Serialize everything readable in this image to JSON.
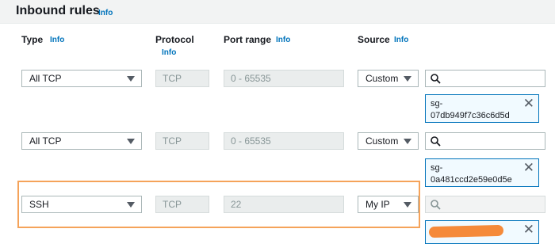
{
  "title": "Inbound rules",
  "info_label": "Info",
  "columns": {
    "type": "Type",
    "protocol": "Protocol",
    "port_range": "Port range",
    "source": "Source"
  },
  "rules": [
    {
      "type": "All TCP",
      "protocol": "TCP",
      "port_range": "0 - 65535",
      "source": "Custom",
      "token_line1": "sg-",
      "token_line2": "07db949f7c36c6d5d"
    },
    {
      "type": "All TCP",
      "protocol": "TCP",
      "port_range": "0 - 65535",
      "source": "Custom",
      "token_line1": "sg-",
      "token_line2": "0a481ccd2e59e0d5e"
    },
    {
      "type": "SSH",
      "protocol": "TCP",
      "port_range": "22",
      "source": "My IP"
    }
  ],
  "token_close": "✕",
  "icons": {
    "search": "search-icon",
    "caret": "caret-down-icon",
    "close": "close-icon"
  },
  "colors": {
    "link": "#0073bb",
    "highlight": "#f5a35a",
    "token_border": "#0073bb"
  }
}
